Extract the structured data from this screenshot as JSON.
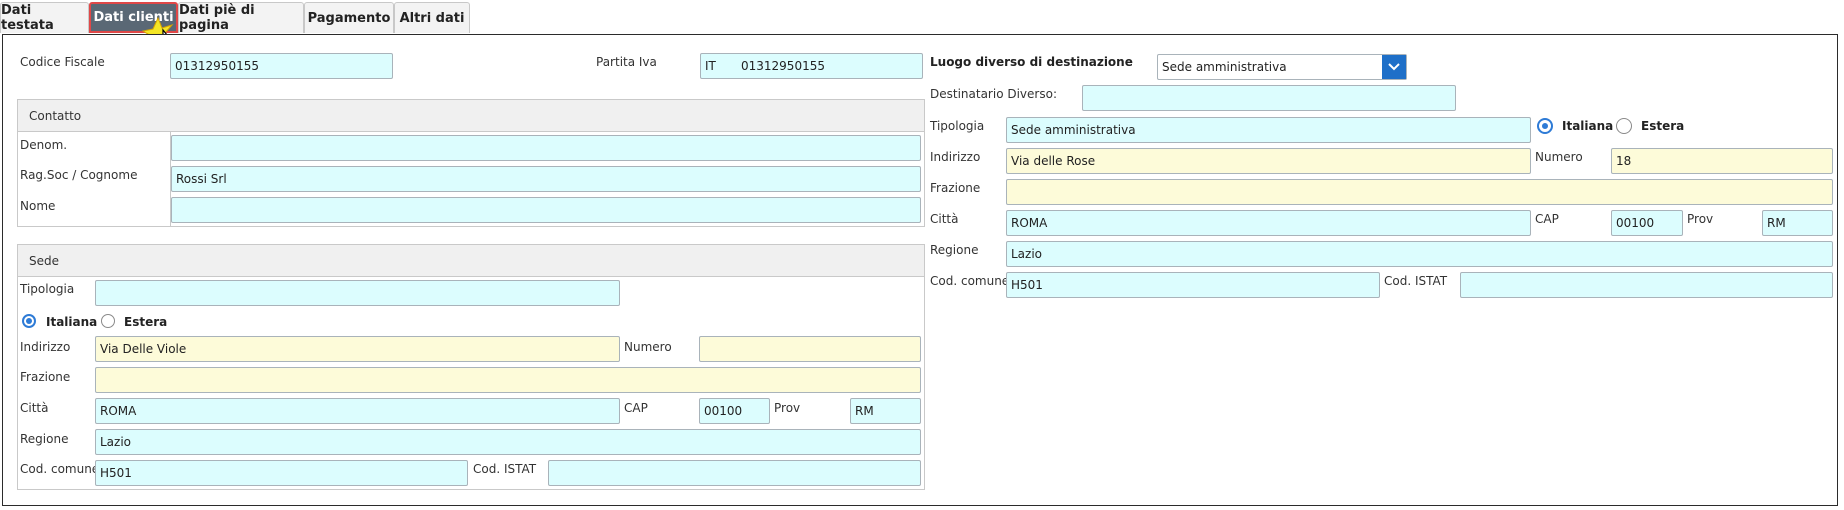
{
  "tabs": [
    "Dati testata",
    "Dati clienti",
    "Dati piè di pagina",
    "Pagamento",
    "Altri dati"
  ],
  "left": {
    "codice_fiscale": {
      "label": "Codice Fiscale",
      "value": "01312950155"
    },
    "partita_iva": {
      "label": "Partita Iva",
      "prefix": "IT",
      "value": "01312950155"
    },
    "contatto": {
      "title": "Contatto",
      "denom": {
        "label": "Denom.",
        "value": ""
      },
      "ragsoc": {
        "label": "Rag.Soc / Cognome",
        "value": "Rossi Srl"
      },
      "nome": {
        "label": "Nome",
        "value": ""
      }
    },
    "sede": {
      "title": "Sede",
      "tipologia": {
        "label": "Tipologia",
        "value": ""
      },
      "radio_italiana": "Italiana",
      "radio_estera": "Estera",
      "indirizzo": {
        "label": "Indirizzo",
        "value": "Via Delle Viole"
      },
      "numero": {
        "label": "Numero",
        "value": ""
      },
      "frazione": {
        "label": "Frazione",
        "value": ""
      },
      "citta": {
        "label": "Città",
        "value": "ROMA"
      },
      "cap": {
        "label": "CAP",
        "value": "00100"
      },
      "prov": {
        "label": "Prov",
        "value": "RM"
      },
      "regione": {
        "label": "Regione",
        "value": "Lazio"
      },
      "cod_comune": {
        "label": "Cod. comune",
        "value": "H501"
      },
      "cod_istat": {
        "label": "Cod. ISTAT",
        "value": ""
      }
    }
  },
  "right": {
    "luogo": {
      "label": "Luogo diverso di destinazione",
      "value": "Sede amministrativa"
    },
    "destinatario": {
      "label": "Destinatario Diverso:",
      "value": ""
    },
    "tipologia": {
      "label": "Tipologia",
      "value": "Sede amministrativa"
    },
    "radio_italiana": "Italiana",
    "radio_estera": "Estera",
    "indirizzo": {
      "label": "Indirizzo",
      "value": "Via delle Rose"
    },
    "numero": {
      "label": "Numero",
      "value": "18"
    },
    "frazione": {
      "label": "Frazione",
      "value": ""
    },
    "citta": {
      "label": "Città",
      "value": "ROMA"
    },
    "cap": {
      "label": "CAP",
      "value": "00100"
    },
    "prov": {
      "label": "Prov",
      "value": "RM"
    },
    "regione": {
      "label": "Regione",
      "value": "Lazio"
    },
    "cod_comune": {
      "label": "Cod. comune",
      "value": "H501"
    },
    "cod_istat": {
      "label": "Cod. ISTAT",
      "value": ""
    }
  },
  "colors": {
    "accent": "#1e6fc8",
    "active_tab": "#5a6875",
    "cyan_field": "#dcfdfe",
    "yellow_field": "#fdfbd9"
  }
}
